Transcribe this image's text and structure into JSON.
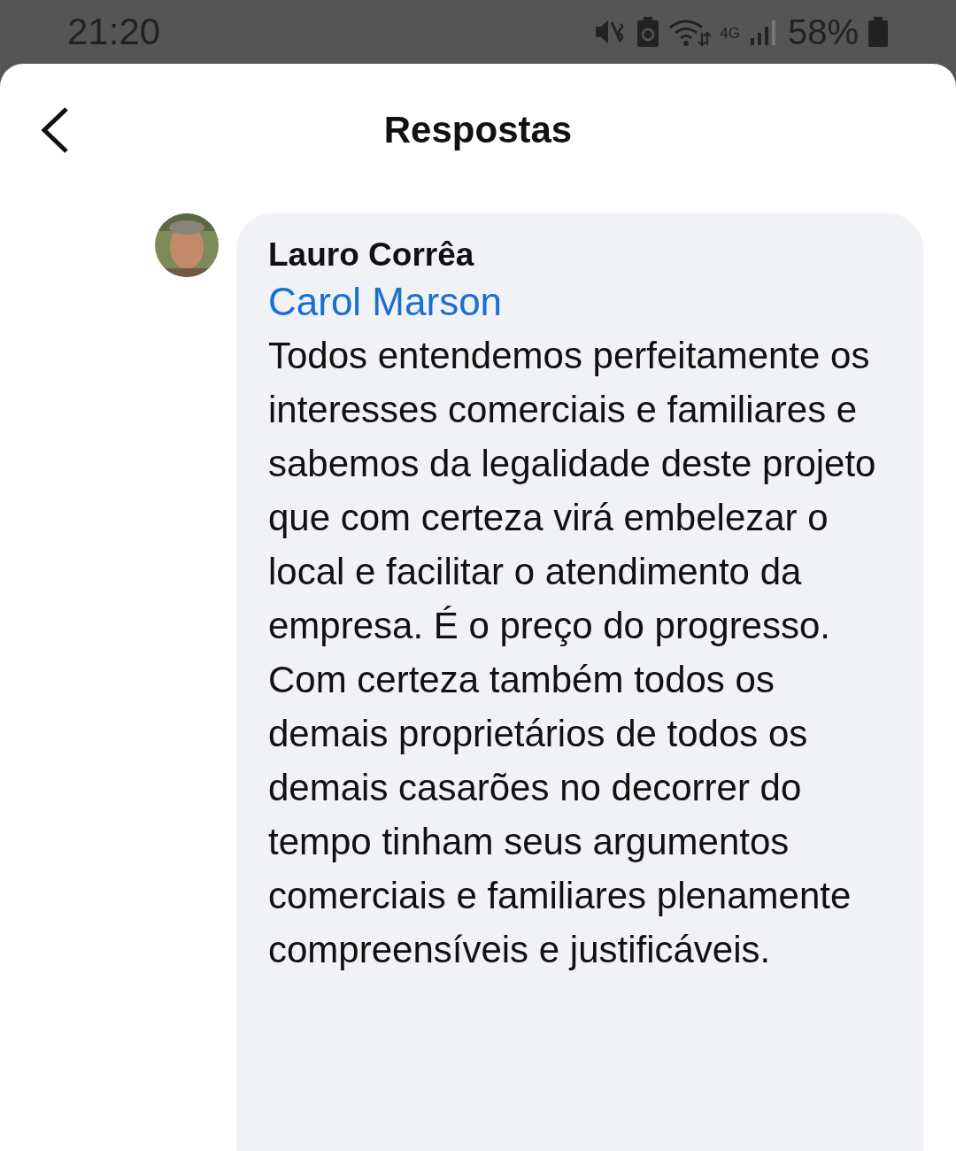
{
  "status_bar": {
    "time": "21:20",
    "network": "4G",
    "battery": "58%"
  },
  "header": {
    "title": "Respostas"
  },
  "comment": {
    "author": "Lauro Corrêa",
    "mention": "Carol Marson",
    "paragraphs": [
      "Todos entendemos perfeitamente os interesses comerciais e familiares e sabemos da legalidade deste projeto que com certeza virá embelezar o local e facilitar o atendimento da empresa. É o preço do progresso.",
      "Com certeza também todos os demais proprietários de todos os demais casarões no decorrer do tempo tinham seus argumentos comerciais e familiares plenamente compreensíveis e justificáveis."
    ]
  }
}
